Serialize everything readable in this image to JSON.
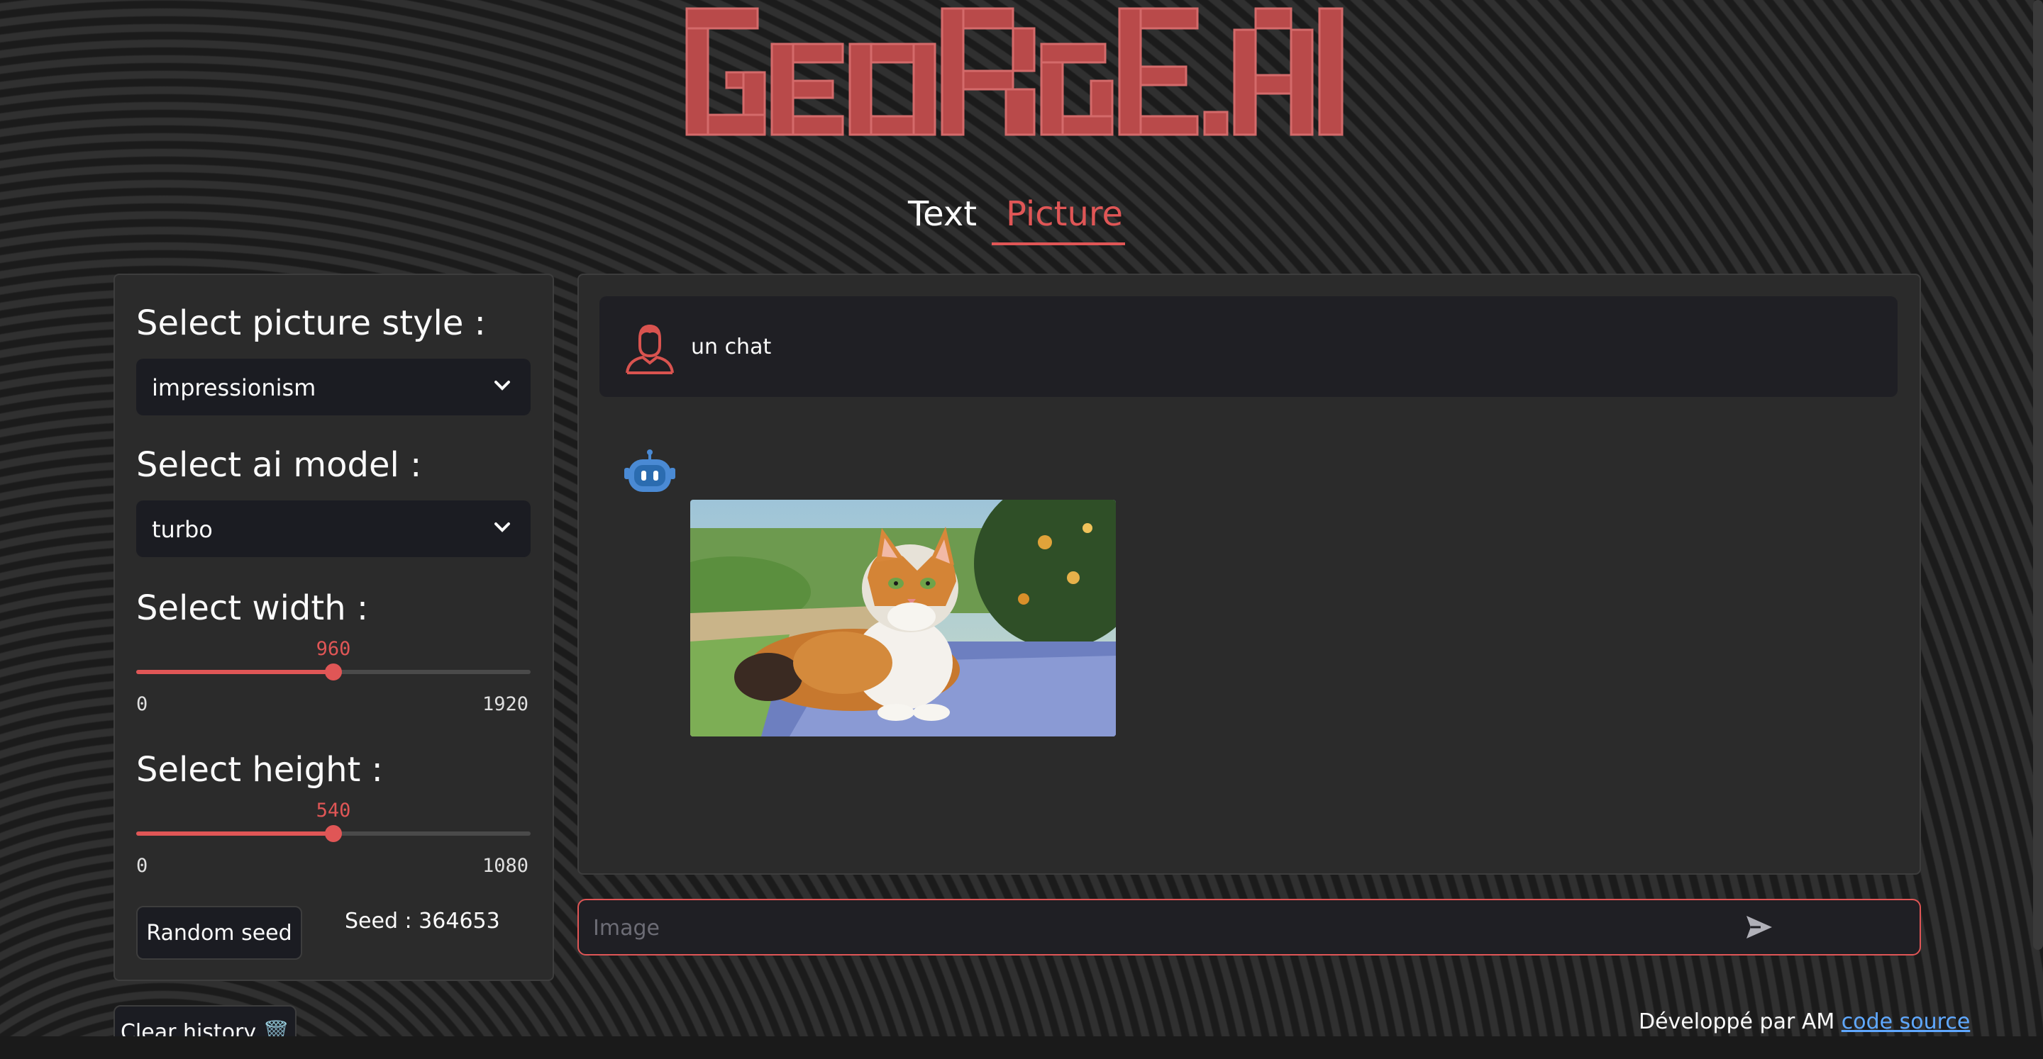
{
  "app": {
    "logo_text": "GEORGE.AI",
    "accent_color": "#e05656"
  },
  "tabs": [
    {
      "label": "Text",
      "active": false
    },
    {
      "label": "Picture",
      "active": true
    }
  ],
  "sidebar": {
    "style_label": "Select picture style :",
    "style_value": "impressionism",
    "model_label": "Select ai model :",
    "model_value": "turbo",
    "width": {
      "label": "Select width :",
      "value": "960",
      "min": "0",
      "max": "1920",
      "fraction": 0.5
    },
    "height": {
      "label": "Select height :",
      "value": "540",
      "min": "0",
      "max": "1080",
      "fraction": 0.5
    },
    "random_seed_label": "Random seed",
    "seed_text": "Seed : 364653",
    "clear_history_label": "Clear history 🗑️"
  },
  "chat": {
    "messages": [
      {
        "role": "user",
        "icon": "user-avatar-icon",
        "text": "un chat"
      },
      {
        "role": "assistant",
        "icon": "robot-avatar-icon",
        "content": "generated-cat-image"
      }
    ],
    "input_placeholder": "Image"
  },
  "footer": {
    "text": "Développé par AM",
    "link_label": "code source"
  }
}
